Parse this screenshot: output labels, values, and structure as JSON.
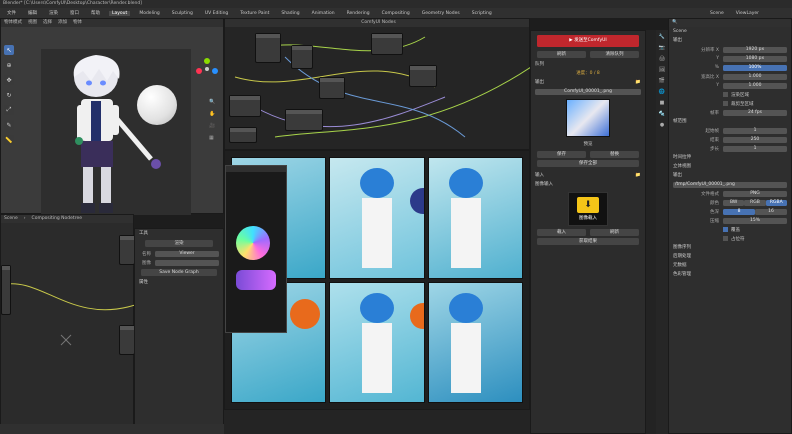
{
  "window": {
    "title": "Blender* [C:\\Users\\ComfyUI\\Desktop\\Character\\Render.blend]"
  },
  "menu": {
    "items": [
      "文件",
      "编辑",
      "渲染",
      "窗口",
      "帮助"
    ],
    "tabs": [
      "Layout",
      "Modeling",
      "Sculpting",
      "UV Editing",
      "Texture Paint",
      "Shading",
      "Animation",
      "Rendering",
      "Compositing",
      "Geometry Nodes",
      "Scripting"
    ],
    "active_tab": "Layout",
    "scene": "Scene",
    "view_layer": "ViewLayer"
  },
  "node_editor": {
    "header": "ComfyUI Nodes",
    "breadcrumb_scene": "Scene",
    "breadcrumb_tree": "Compositing Nodetree"
  },
  "viewport": {
    "mode": "物体模式",
    "view": "视图",
    "select": "选择",
    "add": "添加",
    "object": "物体"
  },
  "comfy_panel": {
    "run_button": "发送至ComfyUI",
    "sub_btn_1": "刷新",
    "sub_btn_2": "清除队列",
    "queue_label": "队列",
    "progress_label": "进度：0 / 8",
    "section_output": "输出",
    "output_file": "ComfyUI_00001_.png",
    "thumb_caption": "预览",
    "btn_a": "保存",
    "btn_b": "替换",
    "btn_c": "保存全部",
    "section_input": "输入",
    "input_label": "图像输入",
    "download_caption": "图像载入",
    "btn_d": "载入",
    "btn_e": "刷新",
    "btn_f": "获取结果"
  },
  "left_panel": {
    "header": "工具",
    "btn_1": "渲染",
    "row_1_label": "名称",
    "row_1_value": "Viewer",
    "row_2_label": "图像",
    "row_3_btn": "Save Node Graph",
    "section": "属性"
  },
  "properties": {
    "scene_name": "Scene",
    "section_output": "输出",
    "res_x_label": "分辨率 X",
    "res_x": "1920 px",
    "res_y_label": "Y",
    "res_y": "1080 px",
    "res_pct_label": "%",
    "res_pct": "100%",
    "aspect_x_label": "宽高比 X",
    "aspect_x": "1.000",
    "aspect_y_label": "Y",
    "aspect_y": "1.000",
    "render_region": "渲染区域",
    "crop": "裁剪至区域",
    "fps_label": "帧率",
    "fps": "24 fps",
    "frame_range": "帧范围",
    "frame_start_label": "起始帧",
    "frame_start": "1",
    "frame_end_label": "结束",
    "frame_end": "250",
    "step_label": "步长",
    "step": "1",
    "time_stretch": "时间拉伸",
    "stereoscopy": "立体视图",
    "output_section": "输出",
    "output_path": "/tmp/ComfyUI_00001_.png",
    "file_format_label": "文件格式",
    "file_format": "PNG",
    "color_label": "颜色",
    "color_bw": "BW",
    "color_rgb": "RGB",
    "color_rgba": "RGBA",
    "depth_label": "色深",
    "depth_8": "8",
    "depth_16": "16",
    "compression_label": "压缩",
    "compression": "15%",
    "overwrite": "覆盖",
    "placeholders": "占位符",
    "image_seq": "图像序列",
    "post_proc": "后期处理",
    "metadata": "元数据",
    "section_color": "色彩管理"
  },
  "colors": {
    "accent_red": "#c0272d",
    "accent_blue": "#4772b3",
    "download_yellow": "#f5c518"
  }
}
